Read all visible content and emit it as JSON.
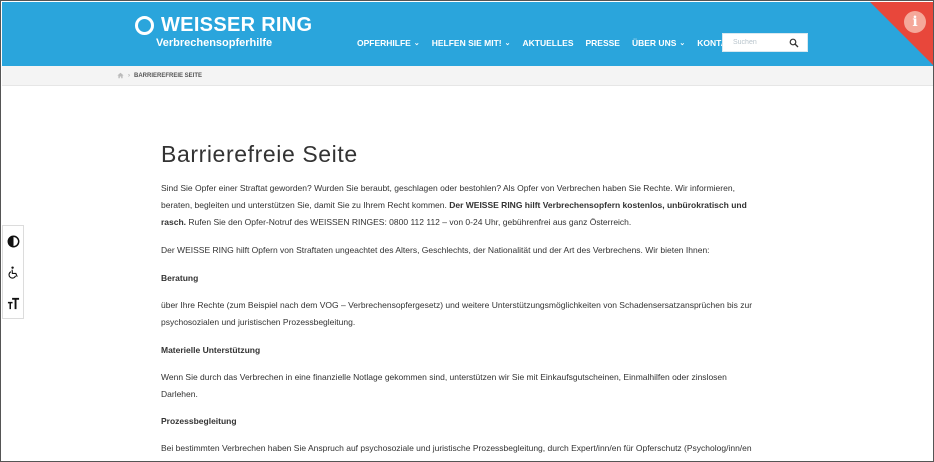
{
  "header": {
    "logo_title": "WEISSER RING",
    "logo_subtitle": "Verbrechensopferhilfe",
    "brand_color": "#2aa5dc",
    "accent_color": "#e8473b",
    "nav": [
      {
        "label": "OPFERHILFE",
        "dropdown": true
      },
      {
        "label": "HELFEN SIE MIT!",
        "dropdown": true
      },
      {
        "label": "AKTUELLES",
        "dropdown": false
      },
      {
        "label": "PRESSE",
        "dropdown": false
      },
      {
        "label": "ÜBER UNS",
        "dropdown": true
      },
      {
        "label": "KONTAKT",
        "dropdown": false
      }
    ],
    "search_placeholder": "Suchen",
    "info_icon": "info-icon"
  },
  "breadcrumb": {
    "home_icon": "home-icon",
    "current": "BARRIEREFREIE SEITE"
  },
  "accessibility": {
    "buttons": [
      "contrast-icon",
      "wheelchair-icon",
      "text-size-icon"
    ]
  },
  "content": {
    "title": "Barrierefreie Seite",
    "intro_part1": "Sind Sie Opfer einer Straftat geworden? Wurden Sie beraubt, geschlagen oder bestohlen? Als Opfer von Verbrechen haben Sie Rechte. Wir informieren, beraten, begleiten und unterstützen Sie, damit Sie zu Ihrem Recht kommen. ",
    "intro_bold": "Der WEISSE RING hilft Verbrechensopfern kostenlos, unbürokratisch und rasch.",
    "intro_part2": " Rufen Sie den Opfer-Notruf des WEISSEN RINGES: 0800 112 112 – von 0-24 Uhr, gebührenfrei aus ganz Österreich.",
    "offer_intro": " Der WEISSE RING hilft Opfern von Straftaten ungeachtet des Alters, Geschlechts, der Nationalität und der Art des Verbrechens. Wir bieten Ihnen:",
    "sections": [
      {
        "heading": "Beratung",
        "text": "über Ihre Rechte (zum Beispiel nach dem VOG – Verbrechensopfergesetz) und weitere Unterstützungsmöglichkeiten von Schadensersatzansprüchen bis zur psychosozialen und juristischen Prozessbegleitung."
      },
      {
        "heading": "Materielle Unterstützung",
        "text": "Wenn Sie durch das Verbrechen in eine finanzielle Notlage gekommen sind, unterstützen wir Sie mit Einkaufsgutscheinen, Einmalhilfen oder zinslosen Darlehen."
      },
      {
        "heading": "Prozessbegleitung",
        "text": "Bei bestimmten Verbrechen haben Sie Anspruch auf psychosoziale und juristische Prozessbegleitung, durch Expert/inn/en für Opferschutz (Psycholog/inn/en oder Anwälte/innen)."
      }
    ]
  }
}
